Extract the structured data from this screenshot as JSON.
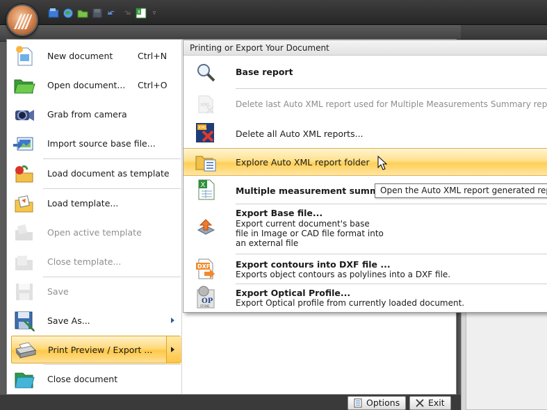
{
  "quick_access": {
    "icons": [
      "open-icon",
      "globe-icon",
      "folder-icon",
      "save-icon",
      "undo-icon",
      "redo-icon",
      "excel-icon"
    ],
    "customize_glyph": "▿"
  },
  "app_menu": {
    "items": [
      {
        "label": "New document",
        "shortcut": "Ctrl+N",
        "icon": "new-document-icon",
        "enabled": true
      },
      {
        "label": "Open document...",
        "shortcut": "Ctrl+O",
        "icon": "open-folder-icon",
        "enabled": true
      },
      {
        "label": "Grab from camera",
        "shortcut": "",
        "icon": "camera-icon",
        "enabled": true
      },
      {
        "label": "Import source base file...",
        "shortcut": "",
        "icon": "import-image-icon",
        "enabled": true
      },
      {
        "label": "Load document as template",
        "shortcut": "",
        "icon": "load-template-doc-icon",
        "enabled": true
      },
      {
        "label": "Load template...",
        "shortcut": "",
        "icon": "load-template-icon",
        "enabled": true
      },
      {
        "label": "Open active template",
        "shortcut": "",
        "icon": "open-template-icon",
        "enabled": false
      },
      {
        "label": "Close template...",
        "shortcut": "",
        "icon": "close-template-icon",
        "enabled": false
      },
      {
        "label": "Save",
        "shortcut": "",
        "icon": "save-icon",
        "enabled": false
      },
      {
        "label": "Save As...",
        "shortcut": "",
        "icon": "save-as-icon",
        "enabled": true,
        "has_submenu": true
      },
      {
        "label": "Print Preview / Export ...",
        "shortcut": "",
        "icon": "printer-icon",
        "enabled": true,
        "has_submenu": true,
        "active": true
      },
      {
        "label": "Close document",
        "shortcut": "",
        "icon": "close-document-icon",
        "enabled": true
      }
    ]
  },
  "submenu": {
    "header": "Printing or Export Your Document",
    "items": [
      {
        "title": "Base report",
        "desc": "",
        "icon": "magnifier-icon",
        "bold": true,
        "enabled": true
      },
      {
        "title": "Delete last Auto XML report used for Multiple Measurements Summary report.",
        "desc": "",
        "icon": "xml-delete-icon",
        "bold": false,
        "enabled": false
      },
      {
        "title": "Delete all Auto XML reports...",
        "desc": "",
        "icon": "xml-delete-all-icon",
        "bold": false,
        "enabled": true
      },
      {
        "title": "Explore Auto XML report folder",
        "desc": "",
        "icon": "folder-list-icon",
        "bold": false,
        "enabled": true,
        "hover": true
      },
      {
        "title": "Multiple measurement summary",
        "desc": "",
        "icon": "excel-sheet-icon",
        "bold": true,
        "enabled": true
      },
      {
        "title": "Export Base file...",
        "desc": "Export current document's base\nfile in Image or CAD file format into\nan external file",
        "icon": "export-arrow-icon",
        "bold": true,
        "enabled": true
      },
      {
        "title": "Export contours into DXF file ...",
        "desc": "Exports object contours as polylines into a DXF file.",
        "icon": "dxf-export-icon",
        "bold": true,
        "enabled": true
      },
      {
        "title": "Export Optical Profile...",
        "desc": "Export Optical profile from currently loaded document.",
        "icon": "optical-profile-icon",
        "bold": true,
        "enabled": true
      }
    ],
    "dxf_badge": "DXF",
    "op_badge": "OP",
    "op_subtext": "STONE"
  },
  "tooltip": "Open the Auto XML report generated report",
  "bottom_buttons": {
    "options": "Options",
    "exit": "Exit"
  },
  "colors": {
    "highlight": "#ffd163",
    "highlight_border": "#d9a52b",
    "chrome_dark": "#2e2e2e",
    "disabled_text": "#8f8f8f"
  }
}
